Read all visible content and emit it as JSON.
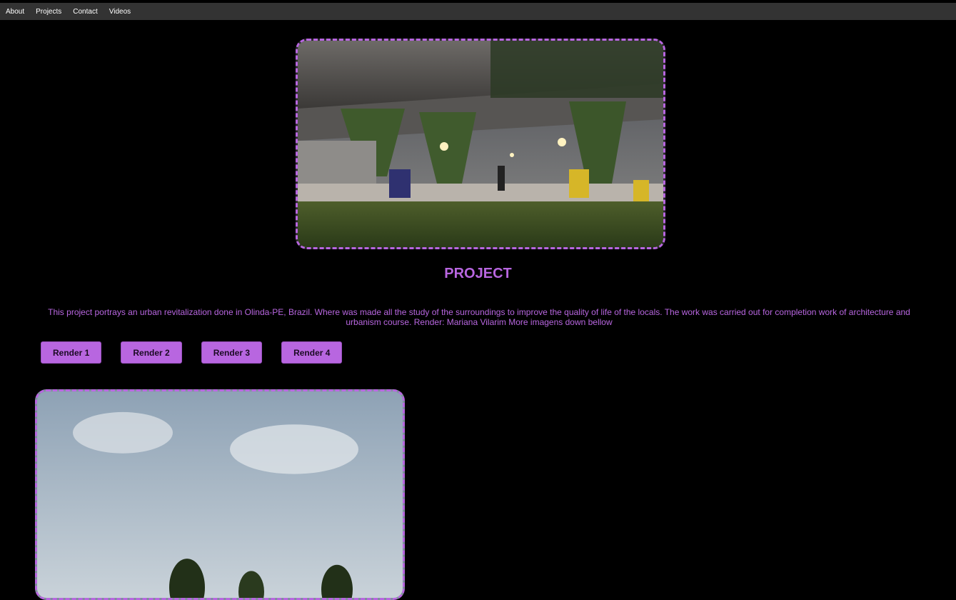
{
  "nav": {
    "items": [
      {
        "label": "About"
      },
      {
        "label": "Projects"
      },
      {
        "label": "Contact"
      },
      {
        "label": "Videos"
      }
    ]
  },
  "main": {
    "title": "PROJECT",
    "description": "This project portrays an urban revitalization done in Olinda-PE, Brazil. Where was made all the study of the surroundings to improve the quality of life of the locals. The work was carried out for completion work of architecture and urbanism course. Render: Mariana Vilarim More imagens down bellow"
  },
  "renders": {
    "buttons": [
      {
        "label": "Render 1"
      },
      {
        "label": "Render 2"
      },
      {
        "label": "Render 3"
      },
      {
        "label": "Render 4"
      }
    ]
  },
  "colors": {
    "accent": "#b866e0",
    "background": "#000000",
    "navbar": "#333333"
  }
}
